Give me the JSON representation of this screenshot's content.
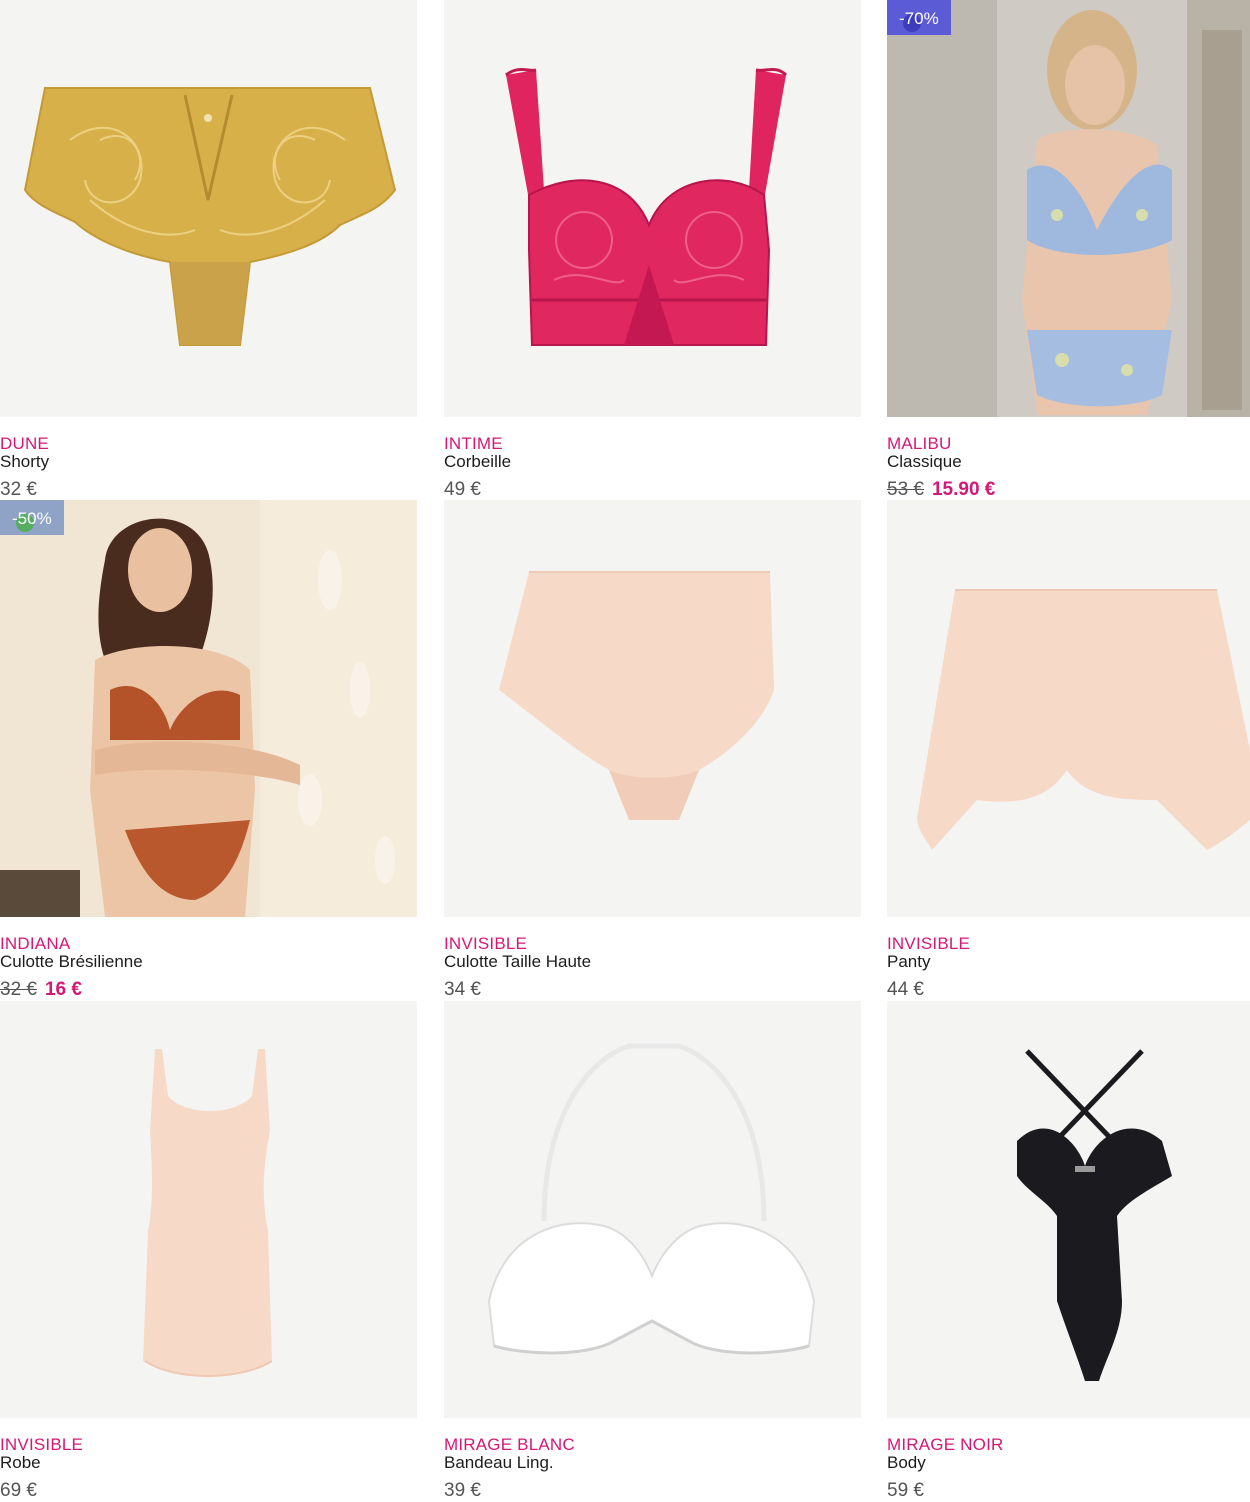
{
  "colors": {
    "brand_pink": "#d41876",
    "badge_purple": "#5b5bd6",
    "badge_steel": "#8fa3c6",
    "image_bg": "#f4f4f3",
    "price_grey": "#555555"
  },
  "products": [
    {
      "brand": "DUNE",
      "name": "Shorty",
      "price": "32 €",
      "image_icon": "lace-shorty-mustard-icon"
    },
    {
      "brand": "INTIME",
      "name": "Corbeille",
      "price": "49 €",
      "image_icon": "lace-bra-fuchsia-icon"
    },
    {
      "brand": "MALIBU",
      "name": "Classique",
      "old_price": "53 €",
      "new_price": "15.90 €",
      "badge": "-70%",
      "image_icon": "model-photo-icon"
    },
    {
      "brand": "INDIANA",
      "name": "Culotte Brésilienne",
      "old_price": "32 €",
      "new_price": "16 €",
      "badge": "-50%",
      "image_icon": "model-photo-icon"
    },
    {
      "brand": "INVISIBLE",
      "name": "Culotte Taille Haute",
      "price": "34 €",
      "image_icon": "high-waist-brief-icon"
    },
    {
      "brand": "INVISIBLE",
      "name": "Panty",
      "price": "44 €",
      "image_icon": "panty-short-icon"
    },
    {
      "brand": "INVISIBLE",
      "name": "Robe",
      "price": "69 €",
      "image_icon": "slip-dress-icon"
    },
    {
      "brand": "MIRAGE BLANC",
      "name": "Bandeau Ling.",
      "price": "39 €",
      "image_icon": "strapless-bra-white-icon"
    },
    {
      "brand": "MIRAGE NOIR",
      "name": "Body",
      "price": "59 €",
      "image_icon": "bodysuit-black-icon"
    }
  ]
}
